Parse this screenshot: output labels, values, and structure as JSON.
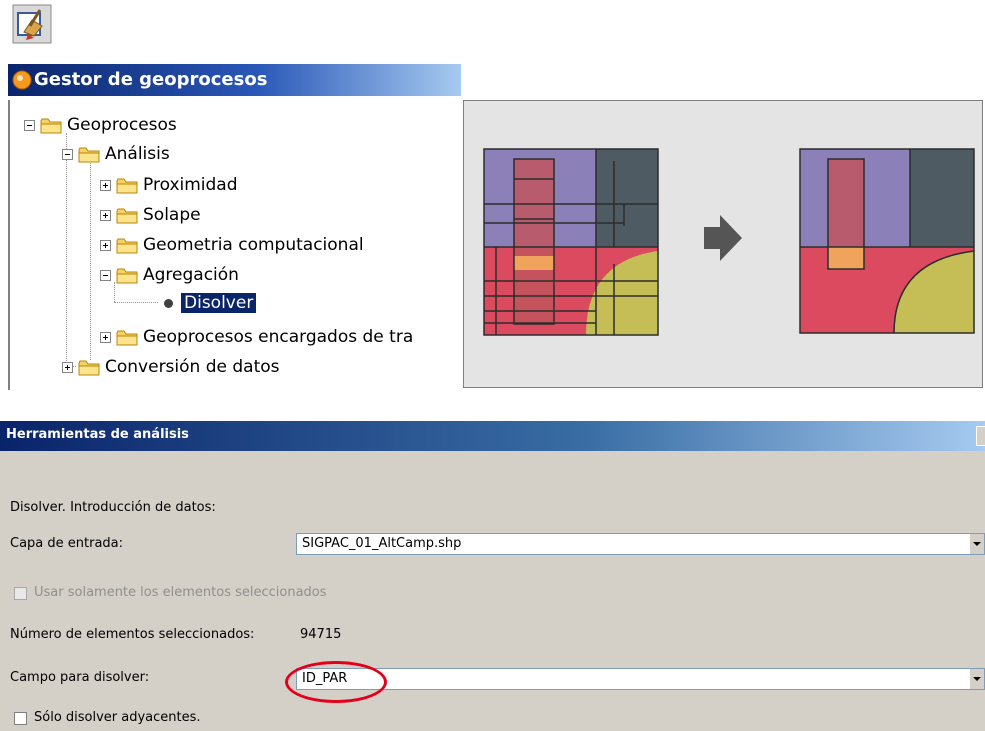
{
  "toolbar": {
    "icon": "geoprocess-tool-icon"
  },
  "geoprocess_manager": {
    "title": "Gestor de geoprocesos",
    "tree": {
      "root": "Geoprocesos",
      "analysis": "Análisis",
      "proximity": "Proximidad",
      "overlap": "Solape",
      "computational_geometry": "Geometria computacional",
      "aggregation": "Agregación",
      "dissolve": "Disolver",
      "custom": "Geoprocesos encargados de tra",
      "data_conversion": "Conversión de datos"
    },
    "selected_item": "Disolver"
  },
  "illustration": {
    "colors": {
      "background": "#e4e4e4",
      "purple": "#8b80b8",
      "slate": "#4f5b63",
      "red": "#dc4a5f",
      "olive": "#c5bd55",
      "orange": "#f0a35a",
      "arrow": "#555555"
    }
  },
  "dialog": {
    "title": "Herramientas de análisis",
    "section_label": "Disolver. Introducción de datos:",
    "input_layer_label": "Capa de entrada:",
    "input_layer_value": "SIGPAC_01_AltCamp.shp",
    "selected_only_label": "Usar solamente los elementos seleccionados",
    "selected_only_checked": false,
    "selected_count_label": "Número de elementos seleccionados:",
    "selected_count_value": "94715",
    "dissolve_field_label": "Campo para disolver:",
    "dissolve_field_value": "ID_PAR",
    "adjacent_only_label": "Sólo disolver adyacentes.",
    "adjacent_only_checked": false,
    "highlight_color": "#e3001b"
  }
}
